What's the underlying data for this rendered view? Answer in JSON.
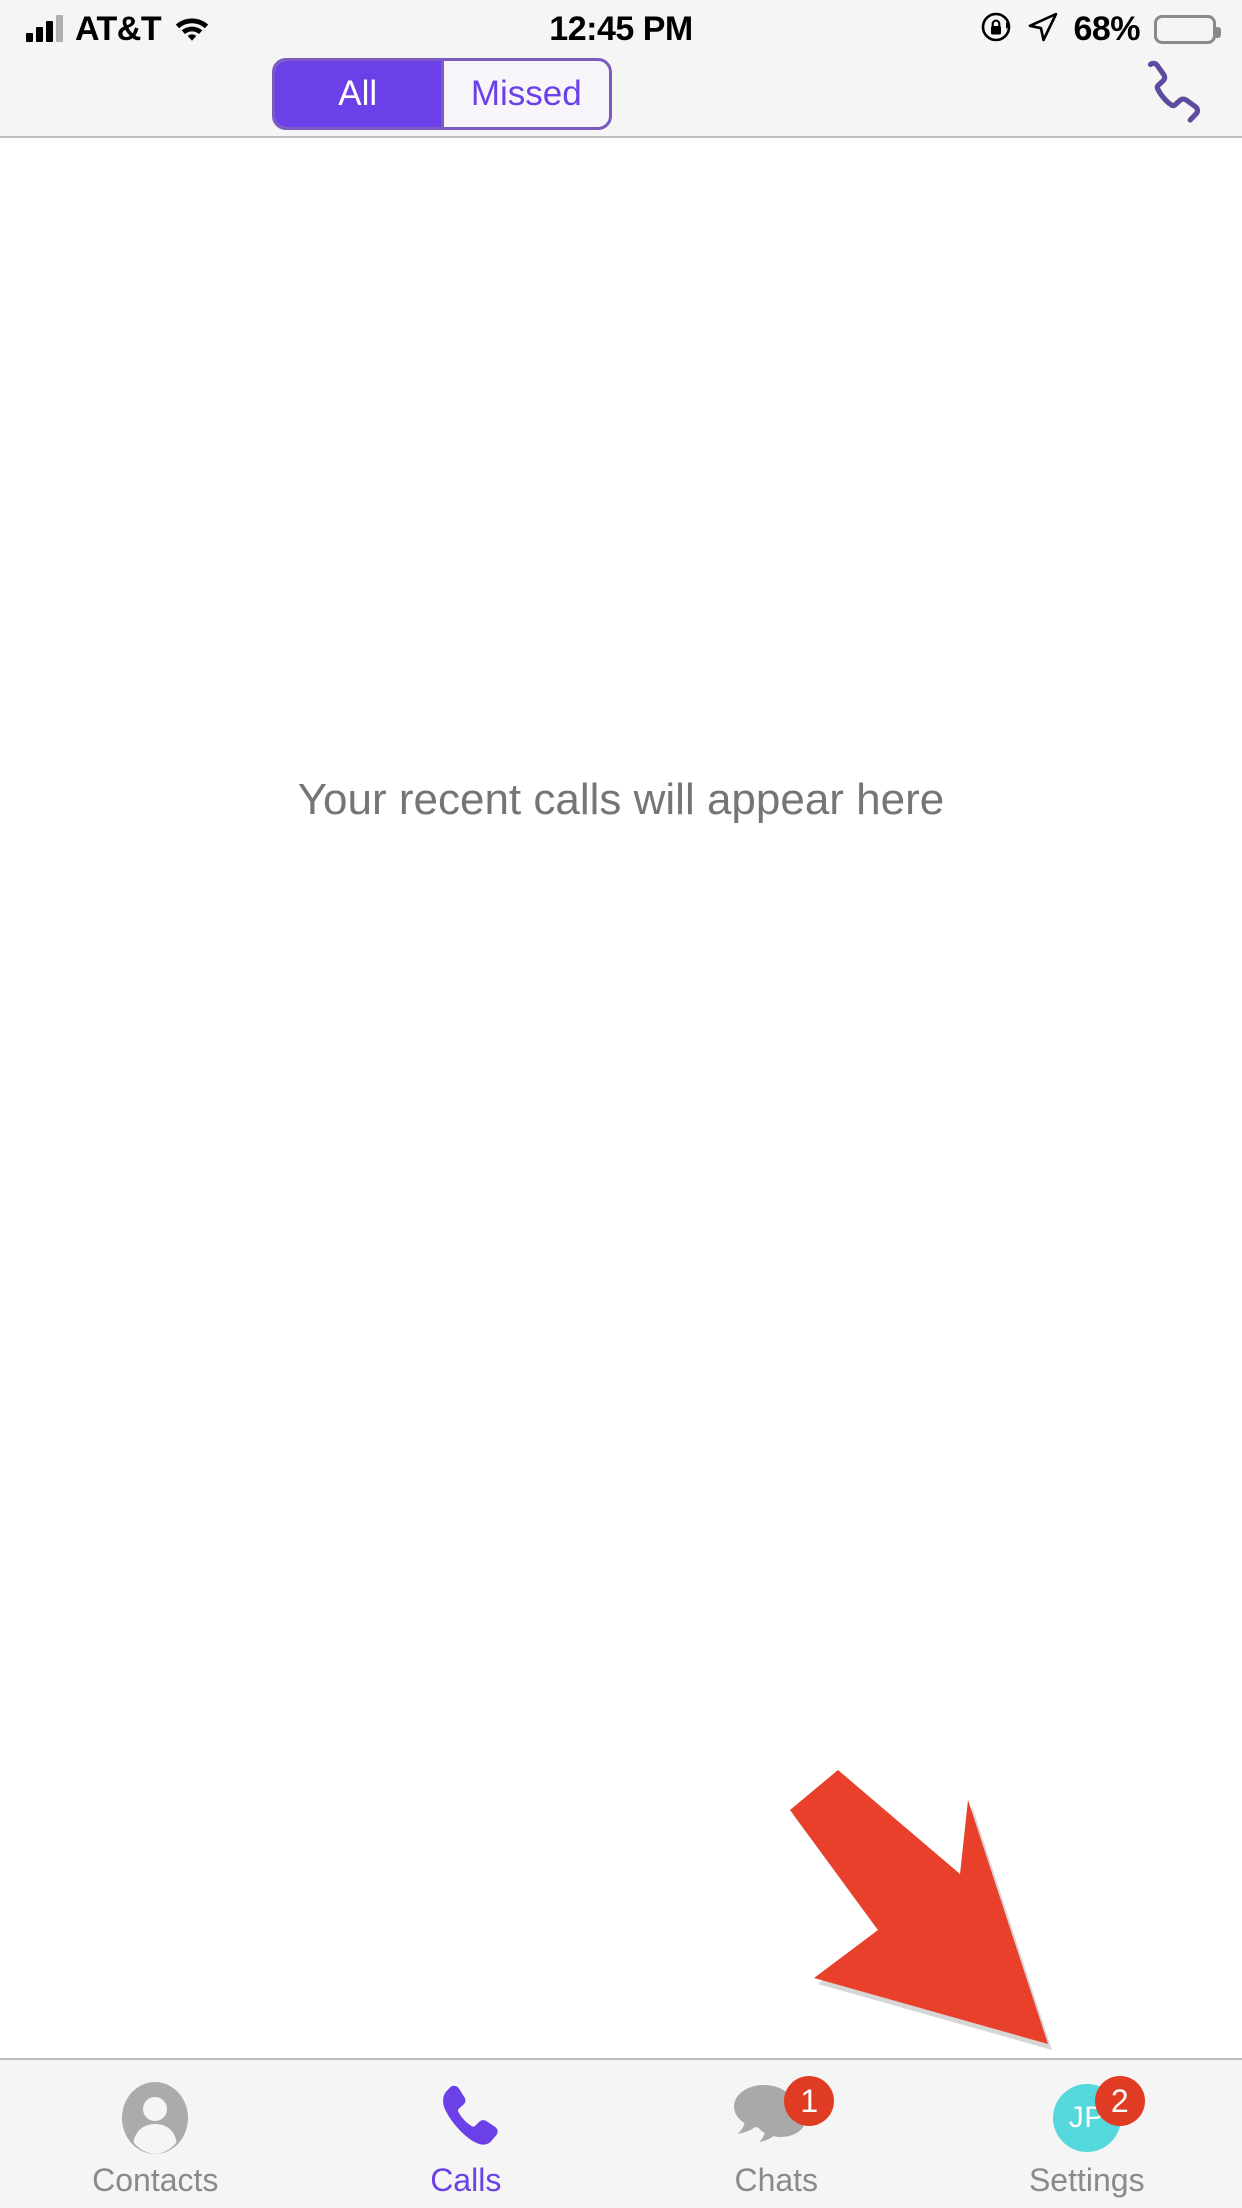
{
  "status_bar": {
    "carrier": "AT&T",
    "time": "12:45 PM",
    "battery_percent": "68%",
    "battery_level": 68,
    "icons": [
      "signal-bars-icon",
      "wifi-icon",
      "rotation-lock-icon",
      "location-arrow-icon",
      "battery-icon"
    ]
  },
  "header": {
    "segments": [
      {
        "label": "All",
        "selected": true
      },
      {
        "label": "Missed",
        "selected": false
      }
    ],
    "call_button_icon": "phone-outline-icon"
  },
  "main": {
    "empty_message": "Your recent calls will appear here",
    "annotation": {
      "type": "arrow",
      "direction": "down-right",
      "color": "#E8402A",
      "points_to": "tab-settings"
    }
  },
  "tab_bar": {
    "tabs": [
      {
        "label": "Contacts",
        "icon": "contact-avatar-icon",
        "active": false,
        "badge": ""
      },
      {
        "label": "Calls",
        "icon": "phone-filled-icon",
        "active": true,
        "badge": ""
      },
      {
        "label": "Chats",
        "icon": "chat-bubbles-icon",
        "active": false,
        "badge": "1"
      },
      {
        "label": "Settings",
        "icon": "user-avatar-initials",
        "initials": "JP",
        "active": false,
        "badge": "2"
      }
    ]
  },
  "colors": {
    "accent_purple": "#6B40E8",
    "segment_border": "#7B5BBF",
    "badge_red": "#E03B23",
    "arrow_red": "#E8402A",
    "avatar_cyan": "#55D8DC",
    "inactive_gray": "#8A8A8A",
    "bar_background": "#F5F5F5"
  }
}
